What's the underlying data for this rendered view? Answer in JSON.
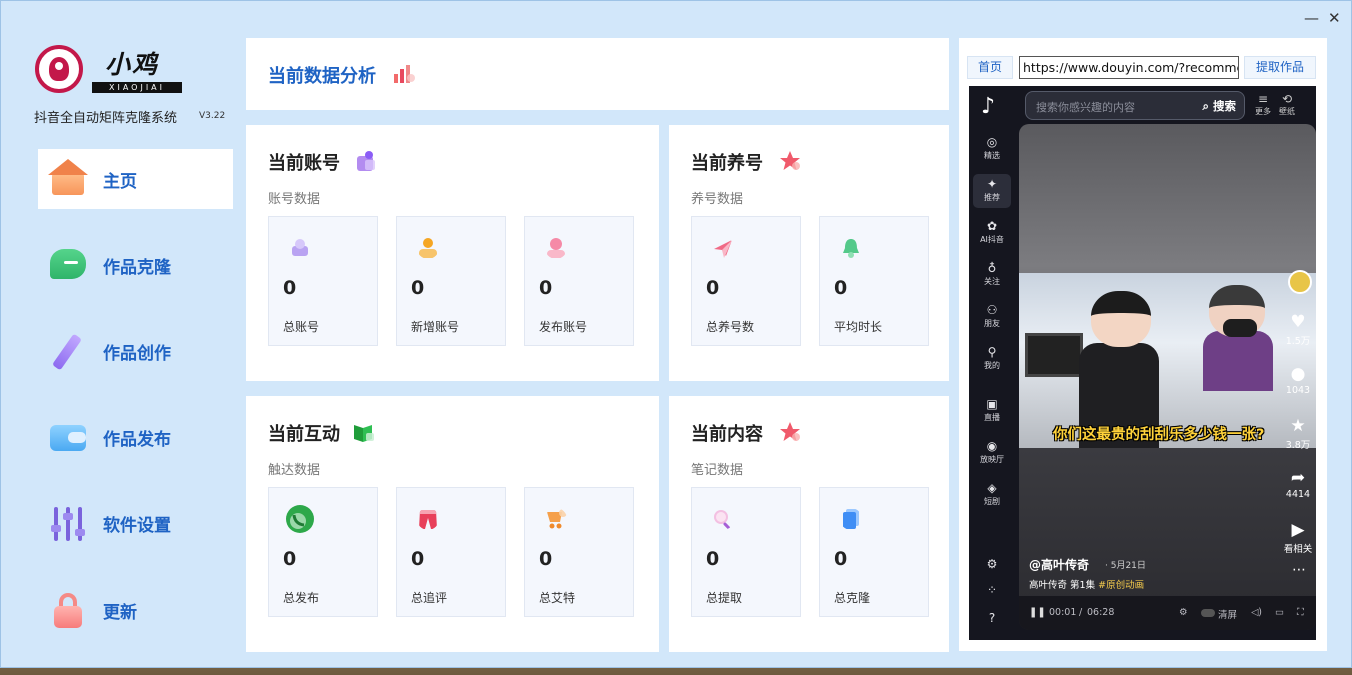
{
  "window": {
    "minimize_glyph": "—",
    "close_glyph": "✕"
  },
  "brand": {
    "title": "小鸡",
    "subtitle": "XIAOJIAI",
    "app_name": "抖音全自动矩阵克隆系统",
    "version": "V3.22",
    "logo_color": "#c3184a"
  },
  "nav": {
    "items": [
      {
        "label": "主页",
        "icon": "house-icon",
        "active": true
      },
      {
        "label": "作品克隆",
        "icon": "chat-bubble-icon",
        "active": false
      },
      {
        "label": "作品创作",
        "icon": "pencil-icon",
        "active": false
      },
      {
        "label": "作品发布",
        "icon": "wallet-icon",
        "active": false
      },
      {
        "label": "软件设置",
        "icon": "sliders-icon",
        "active": false
      },
      {
        "label": "更新",
        "icon": "lock-icon",
        "active": false
      }
    ],
    "accent_color": "#1f63c4"
  },
  "header": {
    "title": "当前数据分析",
    "icon": "bar-chart-icon"
  },
  "sections": {
    "accounts": {
      "title": "当前账号",
      "subtitle": "账号数据",
      "icon": "purple-user-icon",
      "cards": [
        {
          "label": "总账号",
          "value": "0",
          "icon": "cake-icon"
        },
        {
          "label": "新增账号",
          "value": "0",
          "icon": "user-orange-icon"
        },
        {
          "label": "发布账号",
          "value": "0",
          "icon": "user-pink-icon"
        }
      ]
    },
    "nurture": {
      "title": "当前养号",
      "subtitle": "养号数据",
      "icon": "star-icon",
      "cards": [
        {
          "label": "总养号数",
          "value": "0",
          "icon": "paper-plane-icon"
        },
        {
          "label": "平均时长",
          "value": "0",
          "icon": "bell-icon"
        }
      ]
    },
    "interaction": {
      "title": "当前互动",
      "subtitle": "触达数据",
      "icon": "book-icon",
      "cards": [
        {
          "label": "总发布",
          "value": "0",
          "icon": "phone-icon"
        },
        {
          "label": "总追评",
          "value": "0",
          "icon": "pants-icon"
        },
        {
          "label": "总艾特",
          "value": "0",
          "icon": "cart-icon"
        }
      ]
    },
    "content": {
      "title": "当前内容",
      "subtitle": "笔记数据",
      "icon": "star-icon",
      "cards": [
        {
          "label": "总提取",
          "value": "0",
          "icon": "magnifier-icon"
        },
        {
          "label": "总克隆",
          "value": "0",
          "icon": "clone-card-icon"
        }
      ]
    }
  },
  "browser": {
    "home_label": "首页",
    "url": "https://www.douyin.com/?recommend=1",
    "extract_label": "提取作品",
    "douyin": {
      "search_placeholder": "搜索你感兴趣的内容",
      "search_button": "搜索",
      "top_right": [
        "更多",
        "壁纸"
      ],
      "side_items": [
        {
          "label": "精选",
          "icon": "compass-icon"
        },
        {
          "label": "推荐",
          "icon": "sparkle-icon",
          "active": true
        },
        {
          "label": "AI抖音",
          "icon": "ai-icon"
        },
        {
          "label": "关注",
          "icon": "follow-icon"
        },
        {
          "label": "朋友",
          "icon": "friends-icon"
        },
        {
          "label": "我的",
          "icon": "profile-icon"
        },
        {
          "label": "直播",
          "icon": "tv-icon"
        },
        {
          "label": "放映厅",
          "icon": "cinema-icon"
        },
        {
          "label": "短剧",
          "icon": "drama-icon"
        }
      ],
      "caption": "你们这最贵的刮刮乐多少钱一张?",
      "actions": [
        {
          "icon": "heart-icon",
          "count": "1.5万"
        },
        {
          "icon": "comment-icon",
          "count": "1043"
        },
        {
          "icon": "star-icon",
          "count": "3.8万"
        },
        {
          "icon": "share-icon",
          "count": "4414"
        },
        {
          "icon": "related-icon",
          "count": "看相关"
        }
      ],
      "author": "@高叶传奇",
      "date": "· 5月21日",
      "desc": "高叶传奇 第1集",
      "tag": "#原创动画",
      "time_current": "00:01",
      "time_total": "06:28",
      "speed_label": "清屏"
    }
  }
}
